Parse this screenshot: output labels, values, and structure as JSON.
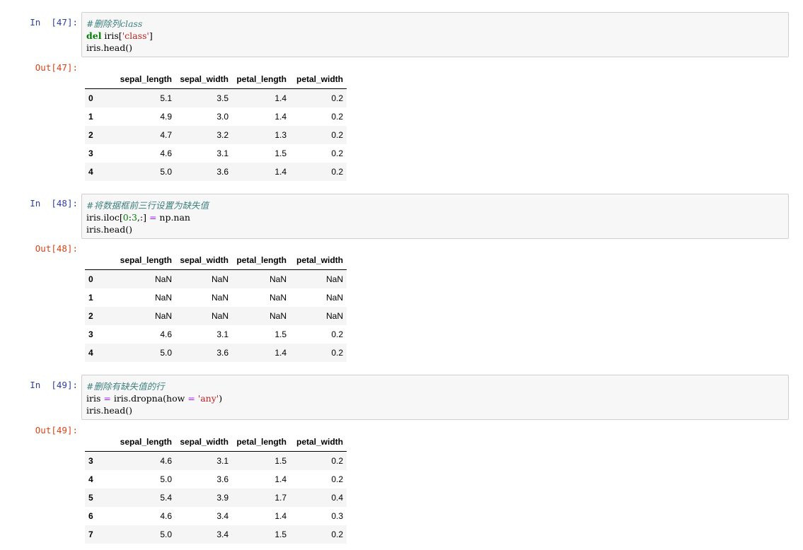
{
  "cells": [
    {
      "in_prompt": "In  [47]:",
      "out_prompt": "Out[47]:",
      "code": {
        "line1_comment": "#删除列class",
        "line2_kw": "del",
        "line2_a": " iris[",
        "line2_str": "'class'",
        "line2_b": "]",
        "line3": "iris.head()"
      },
      "table": {
        "columns": [
          "sepal_length",
          "sepal_width",
          "petal_length",
          "petal_width"
        ],
        "rows": [
          {
            "index": "0",
            "values": [
              "5.1",
              "3.5",
              "1.4",
              "0.2"
            ]
          },
          {
            "index": "1",
            "values": [
              "4.9",
              "3.0",
              "1.4",
              "0.2"
            ]
          },
          {
            "index": "2",
            "values": [
              "4.7",
              "3.2",
              "1.3",
              "0.2"
            ]
          },
          {
            "index": "3",
            "values": [
              "4.6",
              "3.1",
              "1.5",
              "0.2"
            ]
          },
          {
            "index": "4",
            "values": [
              "5.0",
              "3.6",
              "1.4",
              "0.2"
            ]
          }
        ]
      }
    },
    {
      "in_prompt": "In  [48]:",
      "out_prompt": "Out[48]:",
      "code": {
        "line1_comment": "#将数据框前三行设置为缺失值",
        "line2_a": "iris.iloc[",
        "line2_n0": "0",
        "line2_b": ":",
        "line2_n3": "3",
        "line2_c": ",:] ",
        "line2_op": "=",
        "line2_d": " np.nan",
        "line3": "iris.head()"
      },
      "table": {
        "columns": [
          "sepal_length",
          "sepal_width",
          "petal_length",
          "petal_width"
        ],
        "rows": [
          {
            "index": "0",
            "values": [
              "NaN",
              "NaN",
              "NaN",
              "NaN"
            ]
          },
          {
            "index": "1",
            "values": [
              "NaN",
              "NaN",
              "NaN",
              "NaN"
            ]
          },
          {
            "index": "2",
            "values": [
              "NaN",
              "NaN",
              "NaN",
              "NaN"
            ]
          },
          {
            "index": "3",
            "values": [
              "4.6",
              "3.1",
              "1.5",
              "0.2"
            ]
          },
          {
            "index": "4",
            "values": [
              "5.0",
              "3.6",
              "1.4",
              "0.2"
            ]
          }
        ]
      }
    },
    {
      "in_prompt": "In  [49]:",
      "out_prompt": "Out[49]:",
      "code": {
        "line1_comment": "#删除有缺失值的行",
        "line2_a": "iris ",
        "line2_op": "=",
        "line2_b": " iris.dropna(how ",
        "line2_op2": "=",
        "line2_c": " ",
        "line2_str": "'any'",
        "line2_d": ")",
        "line3": "iris.head()"
      },
      "table": {
        "columns": [
          "sepal_length",
          "sepal_width",
          "petal_length",
          "petal_width"
        ],
        "rows": [
          {
            "index": "3",
            "values": [
              "4.6",
              "3.1",
              "1.5",
              "0.2"
            ]
          },
          {
            "index": "4",
            "values": [
              "5.0",
              "3.6",
              "1.4",
              "0.2"
            ]
          },
          {
            "index": "5",
            "values": [
              "5.4",
              "3.9",
              "1.7",
              "0.4"
            ]
          },
          {
            "index": "6",
            "values": [
              "4.6",
              "3.4",
              "1.4",
              "0.3"
            ]
          },
          {
            "index": "7",
            "values": [
              "5.0",
              "3.4",
              "1.5",
              "0.2"
            ]
          }
        ]
      }
    }
  ]
}
